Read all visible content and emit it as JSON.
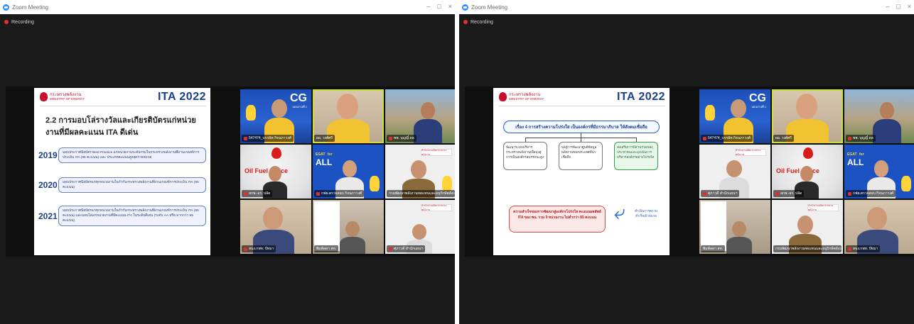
{
  "window": {
    "title": "Zoom Meeting",
    "minimize": "–",
    "maximize": "□",
    "close": "×",
    "recording_label": "Recording"
  },
  "left_slide": {
    "ministry_th": "กระทรวงพลังงาน",
    "ministry_en": "MINISTRY OF ENERGY",
    "logo": "ITA 2022",
    "heading": "2.2 การมอบโล่รางวัลและเกียรติบัตรแก่หน่วยงานที่มีผลคะแนน ITA ดีเด่น",
    "years": [
      {
        "year": "2019",
        "text": "มอบประกาศนียบัตร Best Practice แก่หน่วยงานระดับกรมในกระทรวงพลังงานที่ผ่านเกณฑ์การประเมิน ITA (85 คะแนน) และ ประเภทคะแนนสูงสุดรายหมวด"
      },
      {
        "year": "2020",
        "text": "มอบประกาศนียบัตรแก่ทุกหน่วยงานในกำกับกระทรวงพลังงานที่ผ่านเกณฑ์การประเมิน ITA (85 คะแนน)"
      },
      {
        "year": "2021",
        "text": "มอบประกาศนียบัตรแก่ทุกหน่วยงานในกำกับกระทรวงพลังงานที่ผ่านเกณฑ์การประเมิน ITA (85 คะแนน) และมอบโล่แก่หน่วยงานที่มีคะแนน ITA ในระดับดีเด่น (ระดับ AA หรือ มากกว่า 95 คะแนน)"
      }
    ]
  },
  "right_slide": {
    "ministry_th": "กระทรวงพลังงาน",
    "ministry_en": "MINISTRY OF ENERGY",
    "logo": "ITA 2022",
    "title": "เรื่อง 4 การสร้างความโปร่งใส เป็นองค์กรที่มีธรรมาภิบาล ให้สังคมเชื่อถือ",
    "boxes": [
      "พัฒนาระบบบริหารกระทรวงพลังงานเพื่อมุ่งสู่การเป็นองค์กรสมรรถนะสูง",
      "มุ่งสู่การพัฒนาศูนย์ข้อมูลพลังงานของประเทศที่น่าเชื่อถือ",
      "ส่งเสริมการมีส่วนร่วมของประชาชนและมุ่งเน้นการบริหารองค์กรอย่างโปร่งใส"
    ],
    "result_text": "ความสำเร็จของการพัฒนาสู่องค์กรโปร่งใส คะแนนผลลัพธ์ ITA ของ พน. รวม 9 หน่วยงาน ไม่ต่ำกว่า 85 คะแนน",
    "arrow_label": "ดำเนินการความสำเร็จเป้าหมาย"
  },
  "left_tiles": [
    {
      "name": "547474_บรรษัท กิจนภาวงศ์",
      "bg": "cg"
    },
    {
      "name": "ผอ. วงศ์ศรี",
      "bg": "room"
    },
    {
      "name": "พพ. บุญญิ์ ดล",
      "bg": "outdoor"
    },
    {
      "name": "สกพ.-อร. ปลัด",
      "bg": "fuel"
    },
    {
      "name": "กฟผ.ตรวจสอบ กิจนภาวงศ์",
      "bg": "egat"
    },
    {
      "name": "กรมพัฒนาพลังงานทดแทนและอนุรักษ์พลังงาน",
      "bg": "white"
    },
    {
      "name": "สนง.กพท. ปัทมา",
      "bg": "room"
    },
    {
      "name": "พิมพ์ลดา สท.",
      "bg": "room"
    },
    {
      "name": "ศุภาวดี สำนักแผนฯ",
      "bg": "white"
    }
  ],
  "right_tiles": [
    {
      "name": "547474_บรรษัท กิจนภาวงศ์",
      "bg": "cg"
    },
    {
      "name": "ผอ. วงศ์ศรี",
      "bg": "room"
    },
    {
      "name": "พพ. บุญญิ์ ดล",
      "bg": "outdoor"
    },
    {
      "name": "ศุภาวดี สำนักแผนฯ",
      "bg": "white"
    },
    {
      "name": "สกพ.-อร. ปลัด",
      "bg": "fuel"
    },
    {
      "name": "กฟผ.ตรวจสอบ กิจนภาวงศ์",
      "bg": "egat"
    },
    {
      "name": "พิมพ์ลดา สท.",
      "bg": "room"
    },
    {
      "name": "กรมพัฒนาพลังงานทดแทนและอนุรักษ์พลังงาน",
      "bg": "white"
    },
    {
      "name": "สนง.กพท. ปัทมา",
      "bg": "room"
    }
  ],
  "tile_texts": {
    "cg": "CG",
    "cg_small": "แผนงานที่ 1",
    "egat_top": "EGAT",
    "egat_sub": "for",
    "egat_main": "ALL",
    "fuel": "Oil Fuel Office",
    "banner": "สำนักงานปลัดกระทรวงพลังงาน"
  },
  "colors": {
    "ita_blue": "#1d3f8a",
    "ministry_red": "#c8102e",
    "active_speaker": "#c9e03a",
    "zoom_blue": "#2d8cff"
  }
}
